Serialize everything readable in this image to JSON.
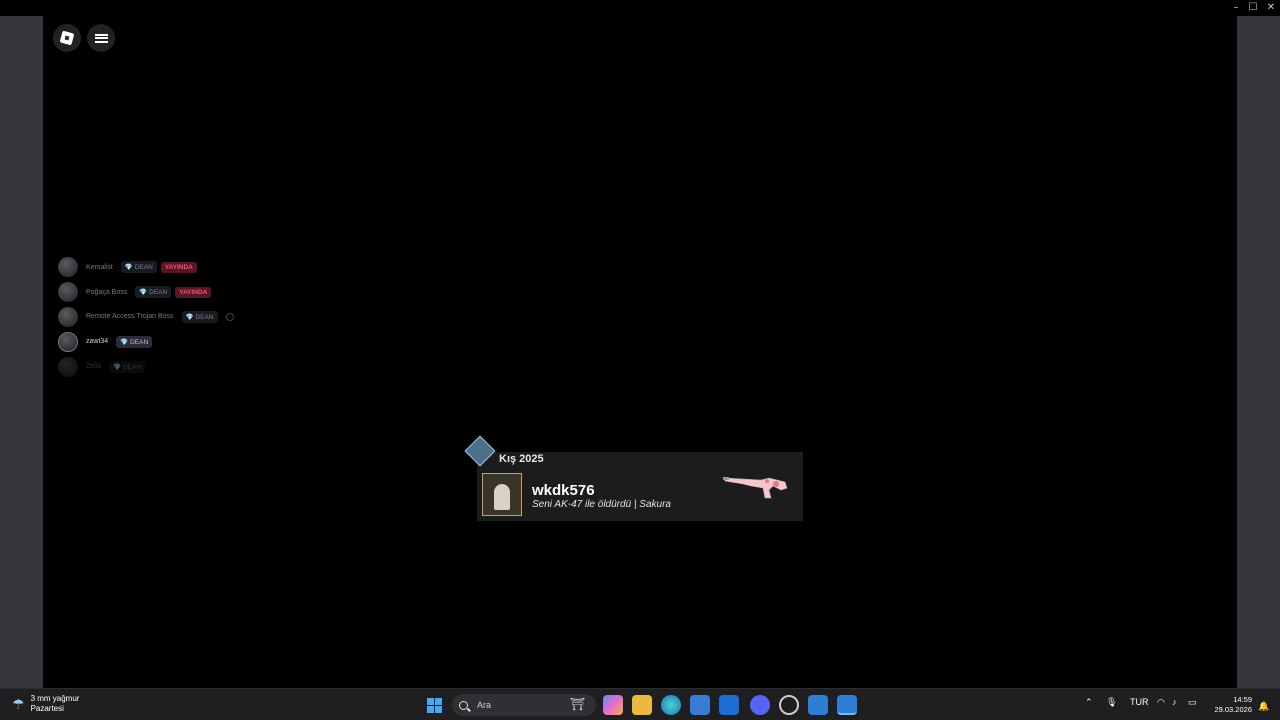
{
  "window": {
    "controls": [
      "–",
      "☐",
      "✕"
    ]
  },
  "game": {
    "menu_buttons": [
      "roblox-menu",
      "hamburger-menu"
    ],
    "player_list": [
      {
        "name": "Kemalist",
        "badge": "💎 DEAN",
        "live": "YAYINDA",
        "state": "faded"
      },
      {
        "name": "Poğaça Boss",
        "badge": "💎 DEAN",
        "live": "YAYINDA",
        "state": "faded"
      },
      {
        "name": "Remote Access Trojan Boss",
        "badge": "💎 DEAN",
        "live": "",
        "state": "faded"
      },
      {
        "name": "zawt34",
        "badge": "💎 DEAN",
        "live": "",
        "state": "active"
      },
      {
        "name": "Zella",
        "badge": "💎 DEAN",
        "live": "",
        "state": "dim"
      }
    ],
    "kill_card": {
      "season": "Kış 2025",
      "killer": "wkdk576",
      "message": "Seni AK-47 ile öldürdü | Sakura"
    }
  },
  "taskbar": {
    "weather": {
      "line1": "3 mm yağmur",
      "line2": "Pazartesi"
    },
    "search_placeholder": "Ara",
    "tray": {
      "language": "TUR"
    },
    "clock": {
      "time": "14:59",
      "date": "29.03.2026"
    }
  }
}
